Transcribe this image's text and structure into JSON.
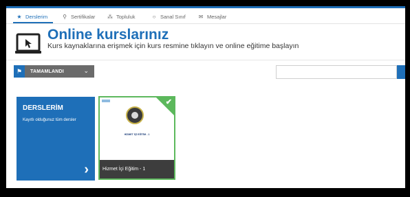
{
  "nav": {
    "items": [
      {
        "label": "Derslerim",
        "icon": "star-icon"
      },
      {
        "label": "Sertifikalar",
        "icon": "ribbon-icon"
      },
      {
        "label": "Topluluk",
        "icon": "community-icon"
      },
      {
        "label": "Sanal Sınıf",
        "icon": "virtual-class-icon"
      },
      {
        "label": "Mesajlar",
        "icon": "mail-icon"
      }
    ],
    "active": "Derslerim"
  },
  "header": {
    "title": "Online kurslarınız",
    "subtitle": "Kurs kaynaklarına erişmek için kurs resmine tıklayın ve online eğitime başlayın"
  },
  "filter": {
    "selected": "TAMAMLANDI"
  },
  "search": {
    "value": "",
    "placeholder": ""
  },
  "summary_card": {
    "title": "DERSLERİM",
    "subtitle": "Kayıtlı olduğunuz tüm dersler"
  },
  "courses": [
    {
      "name": "Hizmet İçi Eğitim - 1",
      "thumb_caption": "HİZMET İÇİ EĞİTİM - 1",
      "completed": true
    }
  ],
  "colors": {
    "primary": "#1e6fb8",
    "success": "#5cb85c",
    "dark": "#3d3d3d",
    "filter_bg": "#6b6b6b"
  }
}
